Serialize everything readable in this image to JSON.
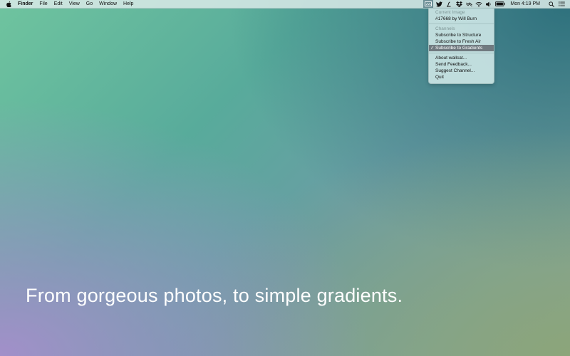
{
  "menubar": {
    "app_name": "Finder",
    "menus": [
      "File",
      "Edit",
      "View",
      "Go",
      "Window",
      "Help"
    ],
    "status_icons": [
      "wallcat-icon",
      "twitter-icon",
      "script-l-icon",
      "dropbox-icon",
      "hopper-icon",
      "wifi-icon",
      "volume-icon",
      "battery-icon"
    ],
    "clock": "Mon 4:19 PM"
  },
  "dropdown": {
    "current_image_header": "Current Image",
    "current_image_value": "#17668 by Will Burn",
    "channels_header": "Channels",
    "channels": [
      {
        "label": "Subscribe to Structure",
        "selected": false
      },
      {
        "label": "Subscribe to Fresh Air",
        "selected": false
      },
      {
        "label": "Subscribe to Gradients",
        "selected": true
      }
    ],
    "check_mark": "✓",
    "actions": [
      "About wallcat...",
      "Send Feedback...",
      "Suggest Channel...",
      "Quit"
    ]
  },
  "desktop": {
    "tagline": "From gorgeous photos, to simple gradients."
  }
}
